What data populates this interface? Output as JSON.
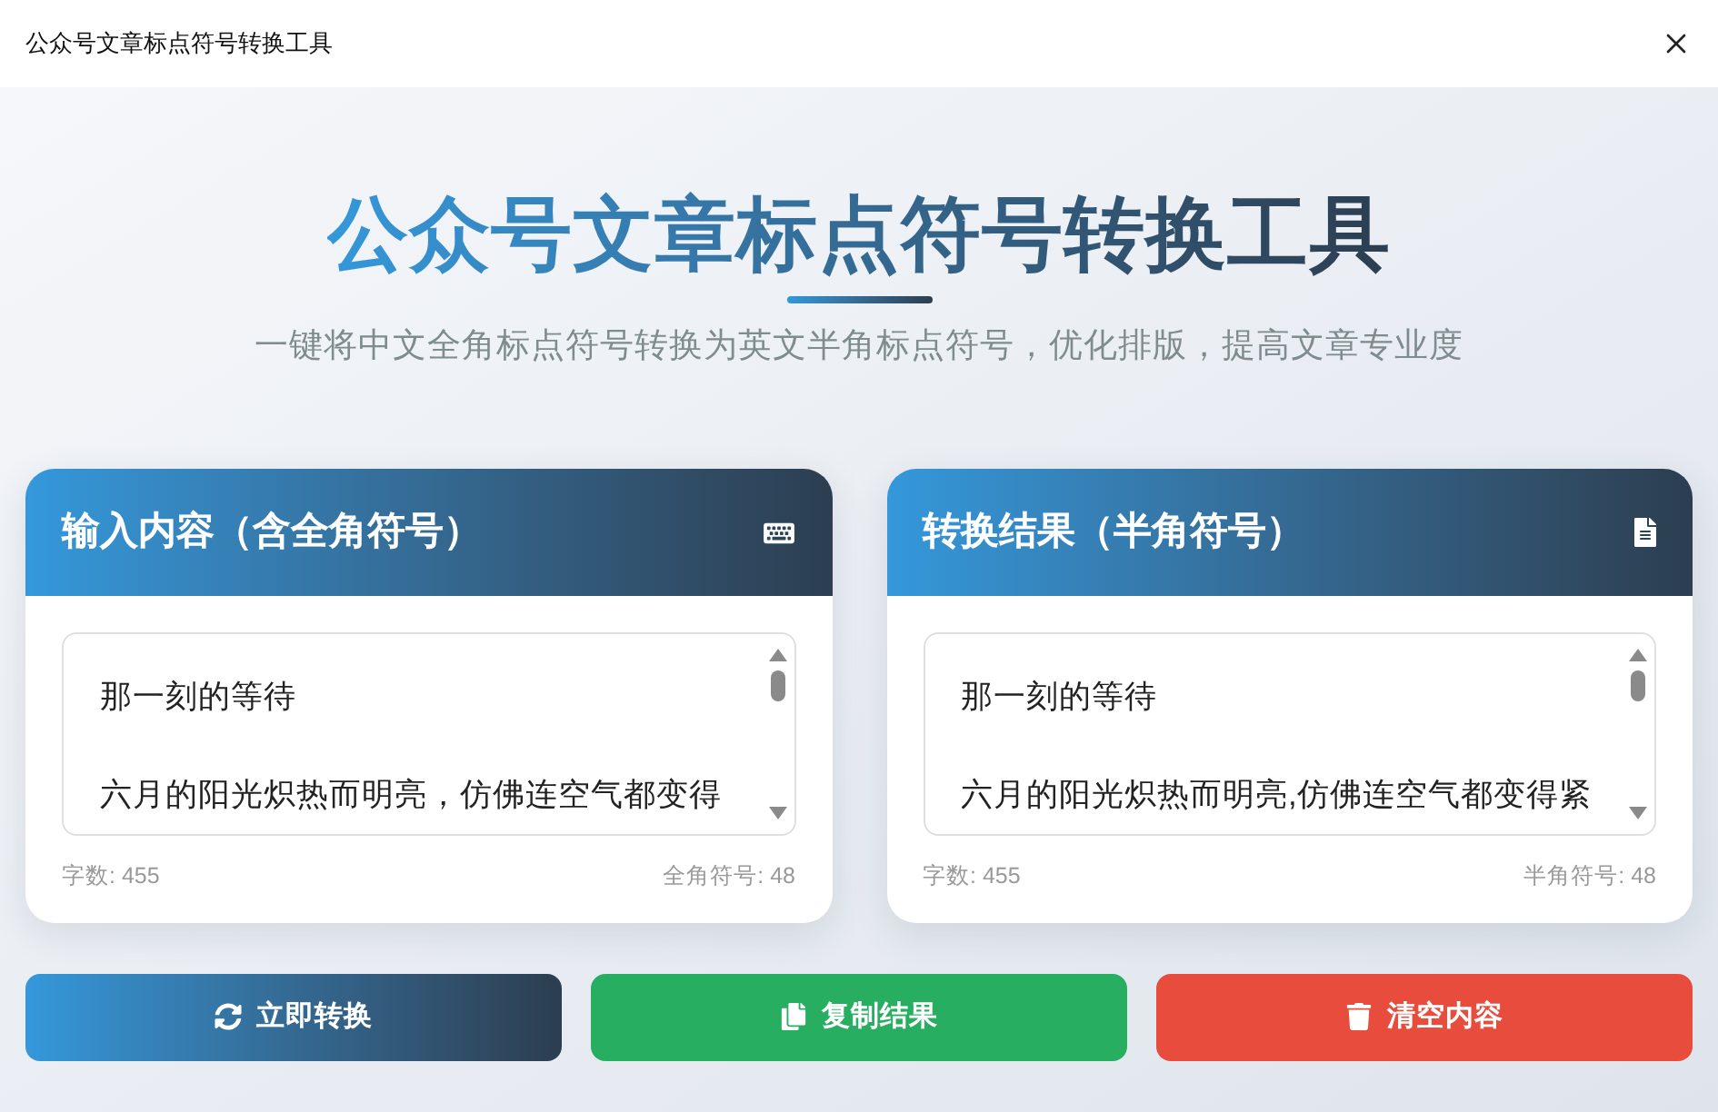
{
  "window": {
    "title": "公众号文章标点符号转换工具"
  },
  "header": {
    "title": "公众号文章标点符号转换工具",
    "subtitle": "一键将中文全角标点符号转换为英文半角标点符号，优化排版，提高文章专业度"
  },
  "panels": [
    {
      "kind": "input",
      "title": "输入内容（含全角符号）",
      "lines": [
        "那一刻的等待",
        "六月的阳光炽热而明亮，仿佛连空气都变得"
      ],
      "char_count": "字数: 455",
      "symbol_count": "全角符号: 48"
    },
    {
      "kind": "output",
      "title": "转换结果（半角符号）",
      "lines": [
        "那一刻的等待",
        "六月的阳光炽热而明亮,仿佛连空气都变得紧"
      ],
      "char_count": "字数: 455",
      "symbol_count": "半角符号: 48"
    }
  ],
  "buttons": [
    {
      "kind": "convert",
      "label": "立即转换"
    },
    {
      "kind": "copy",
      "label": "复制结果"
    },
    {
      "kind": "clear",
      "label": "清空内容"
    }
  ]
}
